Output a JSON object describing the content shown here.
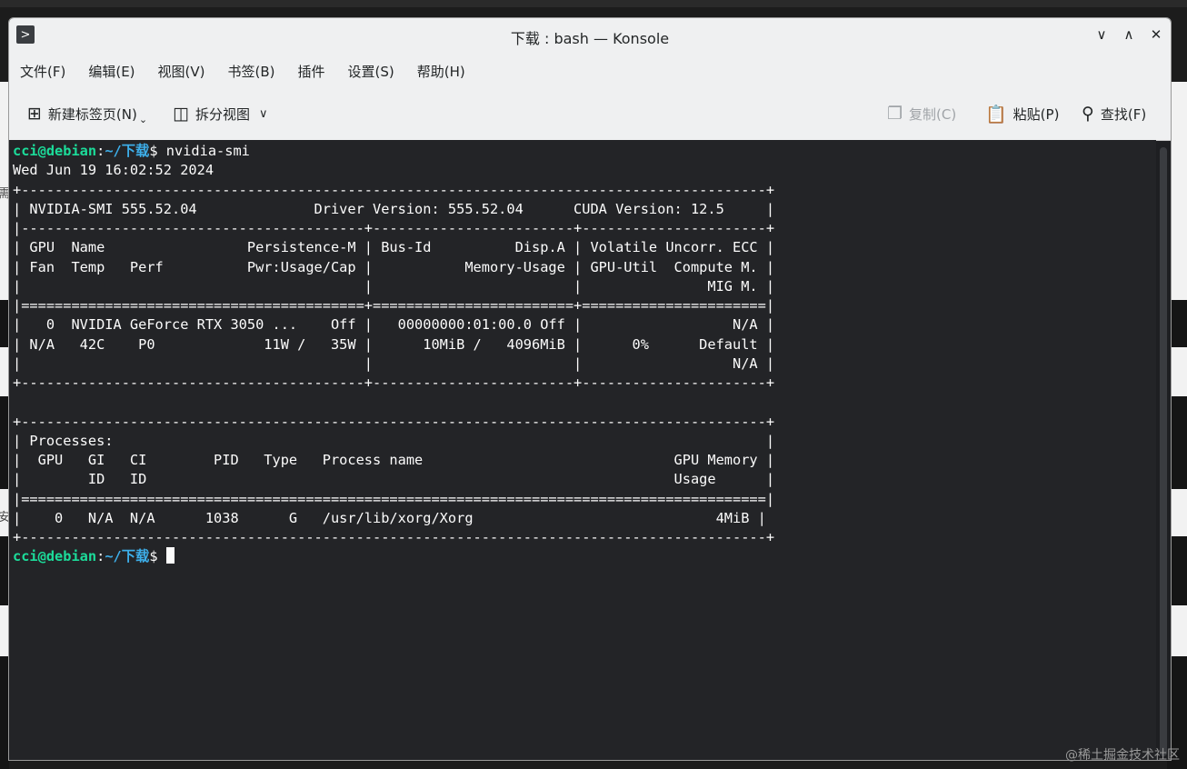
{
  "window": {
    "title": "下载 : bash — Konsole",
    "app_icon_glyph": ">",
    "buttons": {
      "minimize": "∨",
      "maximize": "∧",
      "close": "✕"
    }
  },
  "menubar": {
    "items": [
      "文件(F)",
      "编辑(E)",
      "视图(V)",
      "书签(B)",
      "插件",
      "设置(S)",
      "帮助(H)"
    ]
  },
  "toolbar": {
    "new_tab": "新建标签页(N)",
    "split_view": "拆分视图",
    "copy": "复制(C)",
    "paste": "粘贴(P)",
    "find": "查找(F)"
  },
  "terminal": {
    "prompt_user": "cci@debian",
    "prompt_sep": ":",
    "prompt_path": "~/下载",
    "prompt_suffix": "$ ",
    "command": "nvidia-smi",
    "output": [
      "Wed Jun 19 16:02:52 2024",
      "+-----------------------------------------------------------------------------------------+",
      "| NVIDIA-SMI 555.52.04              Driver Version: 555.52.04      CUDA Version: 12.5     |",
      "|-----------------------------------------+------------------------+----------------------+",
      "| GPU  Name                 Persistence-M | Bus-Id          Disp.A | Volatile Uncorr. ECC |",
      "| Fan  Temp   Perf          Pwr:Usage/Cap |           Memory-Usage | GPU-Util  Compute M. |",
      "|                                         |                        |               MIG M. |",
      "|=========================================+========================+======================|",
      "|   0  NVIDIA GeForce RTX 3050 ...    Off |   00000000:01:00.0 Off |                  N/A |",
      "| N/A   42C    P0             11W /   35W |      10MiB /   4096MiB |      0%      Default |",
      "|                                         |                        |                  N/A |",
      "+-----------------------------------------+------------------------+----------------------+",
      "",
      "+-----------------------------------------------------------------------------------------+",
      "| Processes:                                                                              |",
      "|  GPU   GI   CI        PID   Type   Process name                              GPU Memory |",
      "|        ID   ID                                                               Usage      |",
      "|=========================================================================================|",
      "|    0   N/A  N/A      1038      G   /usr/lib/xorg/Xorg                             4MiB |",
      "+-----------------------------------------------------------------------------------------+"
    ]
  },
  "watermark": "@稀土掘金技术社区",
  "edge_chars": [
    "需",
    "安"
  ]
}
